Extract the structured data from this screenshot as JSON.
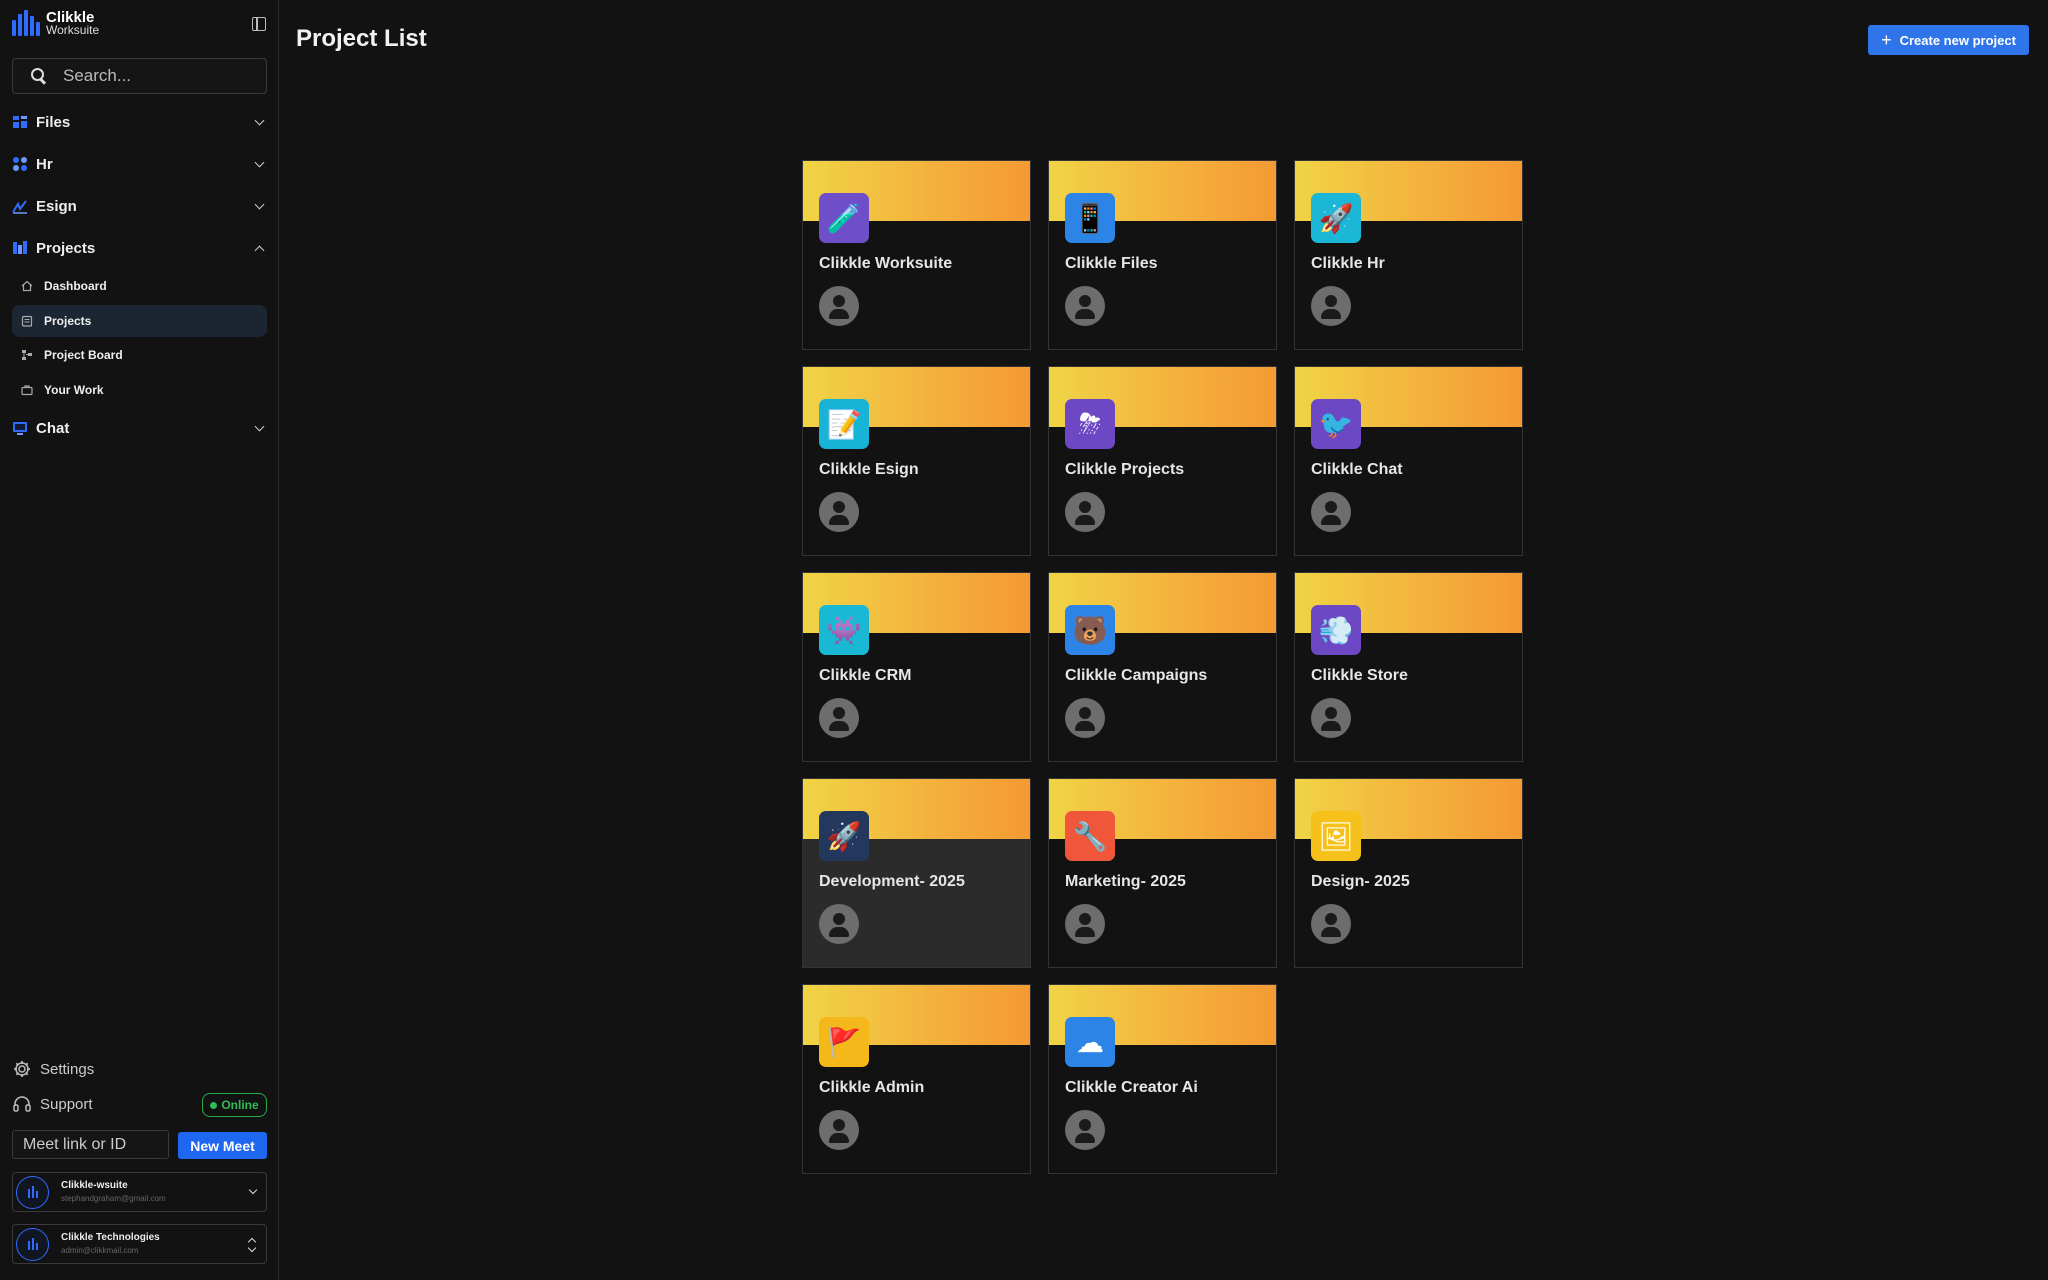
{
  "app": {
    "logo_line1": "Clikkle",
    "logo_line2": "Worksuite",
    "brand_color": "#2f6bff"
  },
  "sidebar": {
    "search_placeholder": "Search...",
    "sections": [
      {
        "label": "Files",
        "icon": "files-icon",
        "expanded": false
      },
      {
        "label": "Hr",
        "icon": "hr-icon",
        "expanded": false
      },
      {
        "label": "Esign",
        "icon": "esign-icon",
        "expanded": false
      },
      {
        "label": "Projects",
        "icon": "projects-icon",
        "expanded": true
      },
      {
        "label": "Chat",
        "icon": "chat-icon",
        "expanded": false
      }
    ],
    "project_items": [
      {
        "label": "Dashboard",
        "icon": "home-icon",
        "active": false
      },
      {
        "label": "Projects",
        "icon": "clipboard-icon",
        "active": true
      },
      {
        "label": "Project Board",
        "icon": "board-icon",
        "active": false
      },
      {
        "label": "Your Work",
        "icon": "briefcase-icon",
        "active": false
      }
    ],
    "settings_label": "Settings",
    "support_label": "Support",
    "status_label": "Online",
    "meet_placeholder": "Meet link or ID",
    "new_meet_label": "New Meet",
    "accounts": [
      {
        "name": "Clikkle-wsuite",
        "email": "stephandgraham@gmail.com"
      },
      {
        "name": "Clikkle Technologies",
        "email": "admin@clikkmail.com"
      }
    ]
  },
  "main": {
    "title": "Project List",
    "create_button_label": "Create new project",
    "projects": [
      {
        "name": "Clikkle Worksuite",
        "icon": "potion-icon",
        "icon_bg": "#6e4fc9"
      },
      {
        "name": "Clikkle Files",
        "icon": "phone-icon",
        "icon_bg": "#2c84e6"
      },
      {
        "name": "Clikkle Hr",
        "icon": "rocket-icon",
        "icon_bg": "#1cb7d6"
      },
      {
        "name": "Clikkle Esign",
        "icon": "notepad-icon",
        "icon_bg": "#18b4d8"
      },
      {
        "name": "Clikkle Projects",
        "icon": "storm-cloud-icon",
        "icon_bg": "#6c48c4"
      },
      {
        "name": "Clikkle Chat",
        "icon": "bird-icon",
        "icon_bg": "#6c48c4"
      },
      {
        "name": "Clikkle CRM",
        "icon": "monster-icon",
        "icon_bg": "#19b9d6"
      },
      {
        "name": "Clikkle Campaigns",
        "icon": "bear-icon",
        "icon_bg": "#2c84e6"
      },
      {
        "name": "Clikkle Store",
        "icon": "hairdryer-icon",
        "icon_bg": "#6c48c4"
      },
      {
        "name": "Development- 2025",
        "icon": "space-rocket-icon",
        "icon_bg": "#23385c"
      },
      {
        "name": "Marketing- 2025",
        "icon": "wrench-icon",
        "icon_bg": "#f0563a"
      },
      {
        "name": "Design- 2025",
        "icon": "easel-icon",
        "icon_bg": "#f5c11a"
      },
      {
        "name": "Clikkle Admin",
        "icon": "flag-icon",
        "icon_bg": "#f5b81a"
      },
      {
        "name": "Clikkle Creator Ai",
        "icon": "cloud-icon",
        "icon_bg": "#2c84e6"
      }
    ]
  }
}
